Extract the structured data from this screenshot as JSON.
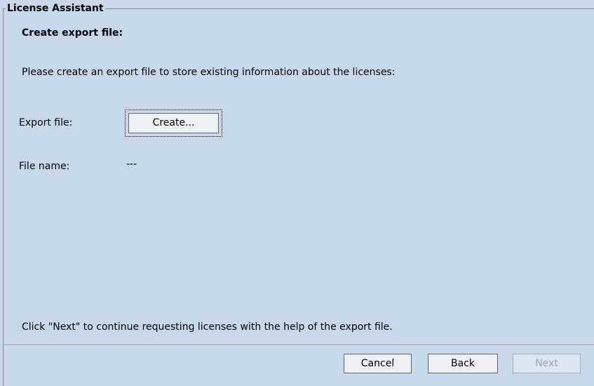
{
  "panel": {
    "title": "License Assistant"
  },
  "content": {
    "section_title": "Create export file:",
    "instruction": "Please create an export file to store existing information about the licenses:",
    "export_file_label": "Export file:",
    "create_button_label": "Create...",
    "file_name_label": "File name:",
    "file_name_value": "---",
    "footer_note": "Click \"Next\" to continue requesting licenses with the help of the export file."
  },
  "buttons": {
    "cancel": "Cancel",
    "back": "Back",
    "next": "Next",
    "next_enabled": false
  }
}
